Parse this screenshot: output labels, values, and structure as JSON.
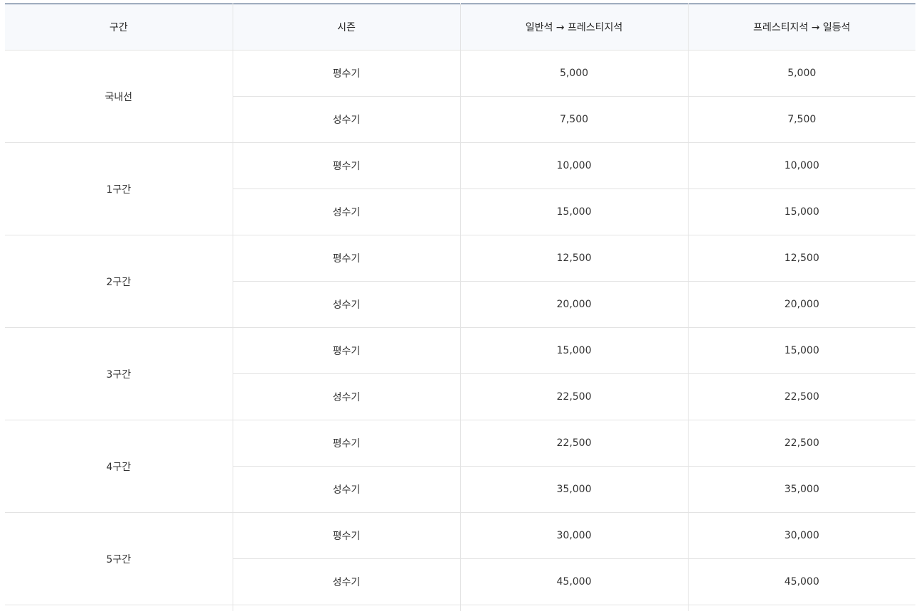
{
  "table": {
    "headers": [
      "구간",
      "시즌",
      "일반석 → 프레스티지석",
      "프레스티지석 → 일등석"
    ],
    "groups": [
      {
        "zone": "국내선",
        "rows": [
          {
            "season": "평수기",
            "economy_to_prestige": "5,000",
            "prestige_to_first": "5,000"
          },
          {
            "season": "성수기",
            "economy_to_prestige": "7,500",
            "prestige_to_first": "7,500"
          }
        ]
      },
      {
        "zone": "1구간",
        "rows": [
          {
            "season": "평수기",
            "economy_to_prestige": "10,000",
            "prestige_to_first": "10,000"
          },
          {
            "season": "성수기",
            "economy_to_prestige": "15,000",
            "prestige_to_first": "15,000"
          }
        ]
      },
      {
        "zone": "2구간",
        "rows": [
          {
            "season": "평수기",
            "economy_to_prestige": "12,500",
            "prestige_to_first": "12,500"
          },
          {
            "season": "성수기",
            "economy_to_prestige": "20,000",
            "prestige_to_first": "20,000"
          }
        ]
      },
      {
        "zone": "3구간",
        "rows": [
          {
            "season": "평수기",
            "economy_to_prestige": "15,000",
            "prestige_to_first": "15,000"
          },
          {
            "season": "성수기",
            "economy_to_prestige": "22,500",
            "prestige_to_first": "22,500"
          }
        ]
      },
      {
        "zone": "4구간",
        "rows": [
          {
            "season": "평수기",
            "economy_to_prestige": "22,500",
            "prestige_to_first": "22,500"
          },
          {
            "season": "성수기",
            "economy_to_prestige": "35,000",
            "prestige_to_first": "35,000"
          }
        ]
      },
      {
        "zone": "5구간",
        "rows": [
          {
            "season": "평수기",
            "economy_to_prestige": "30,000",
            "prestige_to_first": "30,000"
          },
          {
            "season": "성수기",
            "economy_to_prestige": "45,000",
            "prestige_to_first": "45,000"
          }
        ]
      }
    ]
  },
  "colors": {
    "header_bg": "#f7f9fc",
    "top_border": "#1b3a63",
    "grid_line": "#e3e3e3",
    "text": "#333333"
  }
}
